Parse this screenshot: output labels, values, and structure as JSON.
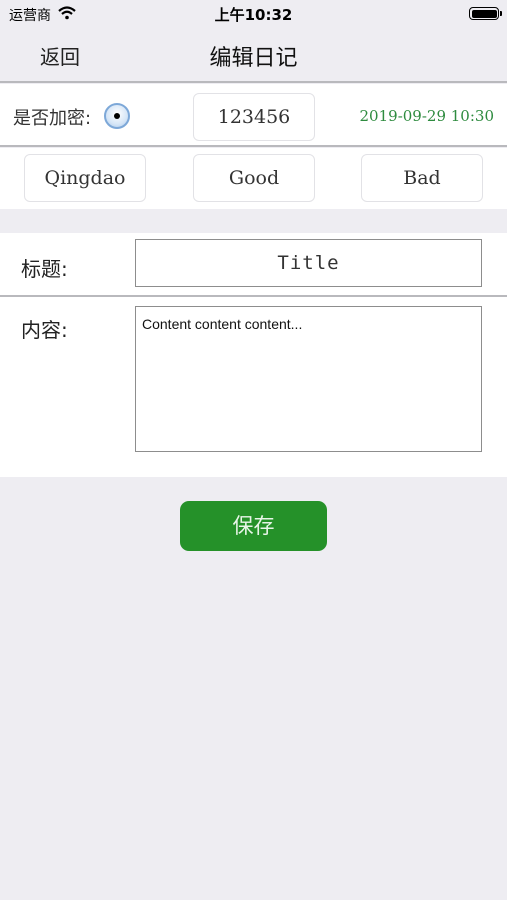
{
  "status_bar": {
    "carrier": "运营商",
    "time": "上午10:32"
  },
  "nav": {
    "back_label": "返回",
    "title": "编辑日记"
  },
  "encrypt": {
    "label": "是否加密:",
    "password": "123456",
    "datetime": "2019-09-29 10:30"
  },
  "tags": {
    "city": "Qingdao",
    "good": "Good",
    "bad": "Bad"
  },
  "form": {
    "title_label": "标题:",
    "title_value": "Title",
    "content_label": "内容:",
    "content_value": "Content content content..."
  },
  "save_label": "保存",
  "colors": {
    "accent_green": "#259129",
    "datetime_green": "#2e8b3f",
    "background": "#eeedf2"
  }
}
